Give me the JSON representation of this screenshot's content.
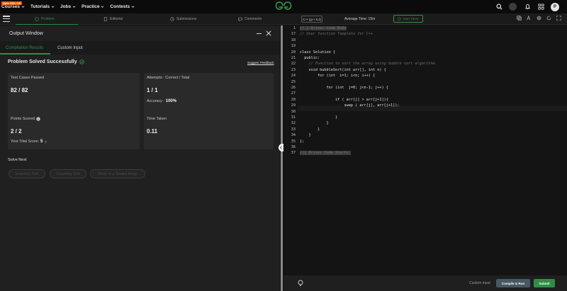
{
  "topnav": {
    "promo": "Upto 90% Off",
    "items": [
      "Courses",
      "Tutorials",
      "Jobs",
      "Practice",
      "Contests"
    ],
    "avatar_letter": "P"
  },
  "problem_tabs": [
    "Problem",
    "Editorial",
    "Submissions",
    "Comments"
  ],
  "editor_toolbar": {
    "language": "C++ (g++ 5.4)",
    "average_time": "Average Time: 15m",
    "start_timer": "Start Timer"
  },
  "output_window": {
    "title": "Output Window",
    "tabs": [
      "Compilation Results",
      "Custom Input"
    ],
    "status": "Problem Solved Successfully",
    "suggest_feedback": "Suggest Feedback",
    "cards": {
      "test_cases_label": "Test Cases Passed",
      "test_cases_value": "82 / 82",
      "attempts_label": "Attempts : Correct / Total",
      "attempts_value": "1 / 1",
      "accuracy_label": "Accuracy :",
      "accuracy_value": "100%",
      "points_label": "Points Scored",
      "points_value": "2 / 2",
      "total_score_label": "Your Total Score:",
      "total_score_value": "5",
      "time_label": "Time Taken",
      "time_value": "0.11"
    },
    "solve_next_label": "Solve Next",
    "solve_next": [
      "Insertion Sort",
      "Counting Sort",
      "Floor in a Sorted Array"
    ]
  },
  "code_lines": [
    {
      "n": "1",
      "text": "// } Driver Code Ends"
    },
    {
      "n": "17",
      "text": "// User function Template for C++"
    },
    {
      "n": "18",
      "text": ""
    },
    {
      "n": "19",
      "text": ""
    },
    {
      "n": "20",
      "text": "class Solution {"
    },
    {
      "n": "21",
      "text": "  public:"
    },
    {
      "n": "22",
      "text": "    // Function to sort the array using bubble sort algorithm."
    },
    {
      "n": "23",
      "text": "    void bubbleSort(int arr[], int n) {"
    },
    {
      "n": "24",
      "text": "        for (int  i=1; i<n; i++) {"
    },
    {
      "n": "25",
      "text": ""
    },
    {
      "n": "26",
      "text": "            for (int  j=0; j<n-1; j++) {"
    },
    {
      "n": "27",
      "text": ""
    },
    {
      "n": "28",
      "text": "                if ( arr[j] > arr[j+1]){"
    },
    {
      "n": "29",
      "text": "                    swap ( arr[j], arr[j+1]);"
    },
    {
      "n": "30",
      "text": ""
    },
    {
      "n": "31",
      "text": "                }"
    },
    {
      "n": "32",
      "text": "            }"
    },
    {
      "n": "33",
      "text": "        }"
    },
    {
      "n": "34",
      "text": "    }"
    },
    {
      "n": "35",
      "text": "};"
    },
    {
      "n": "36",
      "text": ""
    },
    {
      "n": "37",
      "text": "//{ Driver Code Starts."
    }
  ],
  "bottom": {
    "custom_input": "Custom Input",
    "compile_run": "Compile & Run",
    "submit": "Submit"
  },
  "colors": {
    "accent_green": "#2f8d46",
    "promo_orange": "#e8590c",
    "run_button": "#465861"
  }
}
